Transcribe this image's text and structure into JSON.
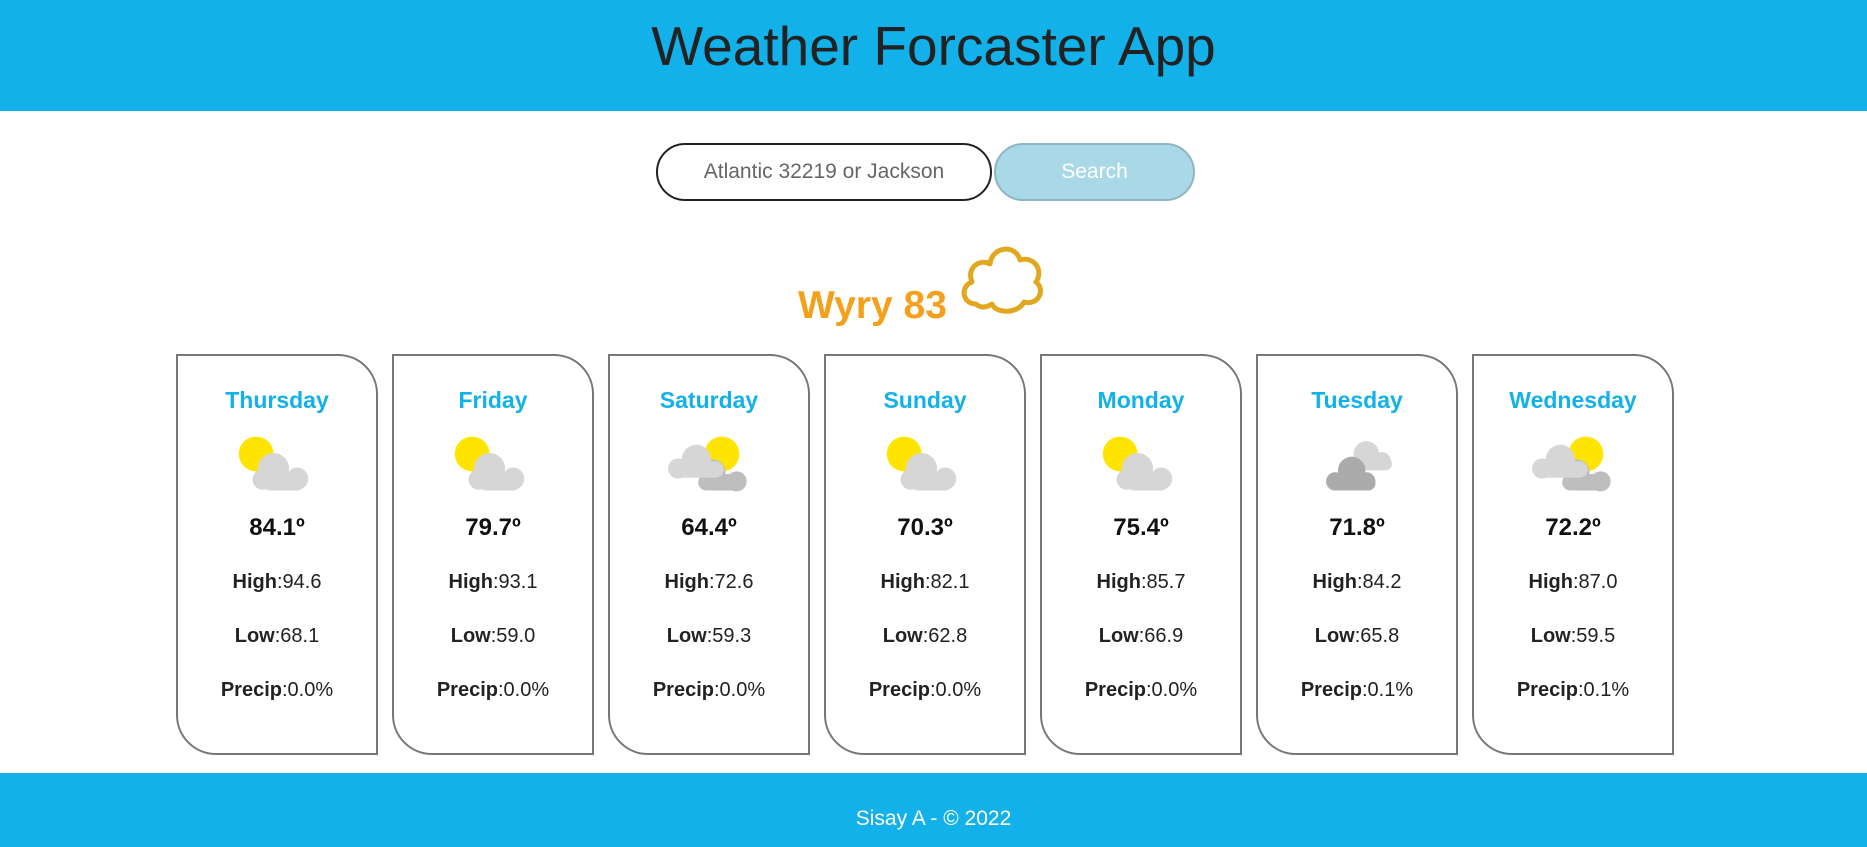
{
  "header": {
    "title": "Weather Forcaster App"
  },
  "search": {
    "placeholder": "Atlantic 32219 or Jackson",
    "button_label": "Search"
  },
  "current": {
    "city": "Wyry",
    "temp": "83",
    "icon": "cloud-outline-icon",
    "icon_color": "#e0a81e"
  },
  "labels": {
    "high": "High",
    "low": "Low",
    "precip": "Precip"
  },
  "forecast": [
    {
      "day": "Thursday",
      "icon": "partly-cloudy-icon",
      "temp": "84.1º",
      "high": ":94.6",
      "low": ":68.1",
      "precip": ":0.0%"
    },
    {
      "day": "Friday",
      "icon": "partly-cloudy-icon",
      "temp": "79.7º",
      "high": ":93.1",
      "low": ":59.0",
      "precip": ":0.0%"
    },
    {
      "day": "Saturday",
      "icon": "mostly-cloudy-icon",
      "temp": "64.4º",
      "high": ":72.6",
      "low": ":59.3",
      "precip": ":0.0%"
    },
    {
      "day": "Sunday",
      "icon": "partly-cloudy-icon",
      "temp": "70.3º",
      "high": ":82.1",
      "low": ":62.8",
      "precip": ":0.0%"
    },
    {
      "day": "Monday",
      "icon": "partly-cloudy-icon",
      "temp": "75.4º",
      "high": ":85.7",
      "low": ":66.9",
      "precip": ":0.0%"
    },
    {
      "day": "Tuesday",
      "icon": "overcast-icon",
      "temp": "71.8º",
      "high": ":84.2",
      "low": ":65.8",
      "precip": ":0.1%"
    },
    {
      "day": "Wednesday",
      "icon": "mostly-cloudy-icon",
      "temp": "72.2º",
      "high": ":87.0",
      "low": ":59.5",
      "precip": ":0.1%"
    }
  ],
  "footer": {
    "text": "Sisay A - © 2022"
  },
  "colors": {
    "accent": "#13b1ea",
    "current": "#f5a01c",
    "button": "#a9d8e6"
  }
}
